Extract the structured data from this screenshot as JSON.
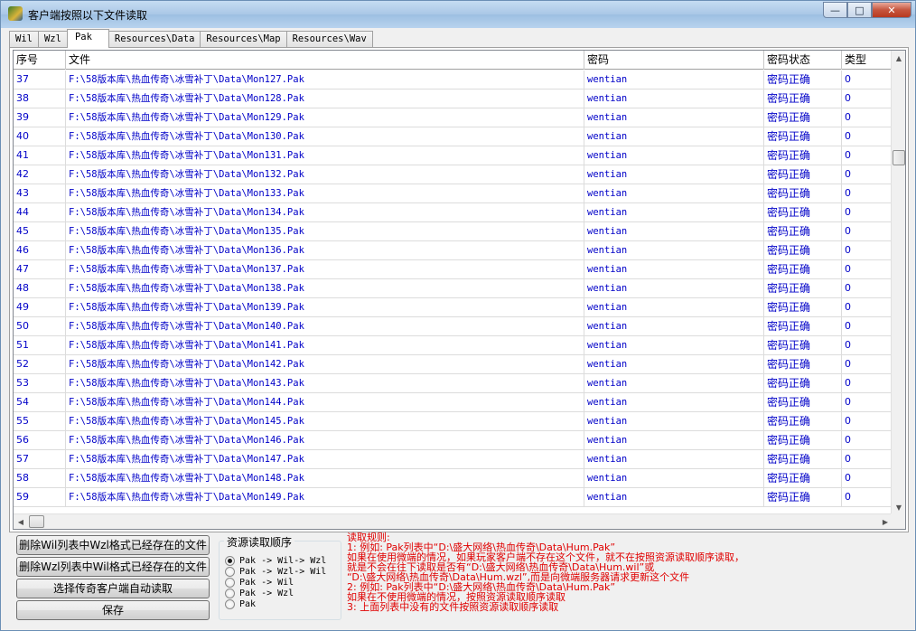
{
  "window": {
    "title": "客户端按照以下文件读取"
  },
  "title_buttons": {
    "minimize": "—",
    "maximize": "□",
    "close": "✕"
  },
  "tabs": [
    "Wil",
    "Wzl",
    "Pak",
    "Resources\\Data",
    "Resources\\Map",
    "Resources\\Wav"
  ],
  "active_tab": "Pak",
  "table": {
    "columns": [
      "序号",
      "文件",
      "密码",
      "密码状态",
      "类型"
    ],
    "rows": [
      [
        "37",
        "F:\\58版本库\\热血传奇\\冰雪补丁\\Data\\Mon127.Pak",
        "wentian",
        "密码正确",
        "0"
      ],
      [
        "38",
        "F:\\58版本库\\热血传奇\\冰雪补丁\\Data\\Mon128.Pak",
        "wentian",
        "密码正确",
        "0"
      ],
      [
        "39",
        "F:\\58版本库\\热血传奇\\冰雪补丁\\Data\\Mon129.Pak",
        "wentian",
        "密码正确",
        "0"
      ],
      [
        "40",
        "F:\\58版本库\\热血传奇\\冰雪补丁\\Data\\Mon130.Pak",
        "wentian",
        "密码正确",
        "0"
      ],
      [
        "41",
        "F:\\58版本库\\热血传奇\\冰雪补丁\\Data\\Mon131.Pak",
        "wentian",
        "密码正确",
        "0"
      ],
      [
        "42",
        "F:\\58版本库\\热血传奇\\冰雪补丁\\Data\\Mon132.Pak",
        "wentian",
        "密码正确",
        "0"
      ],
      [
        "43",
        "F:\\58版本库\\热血传奇\\冰雪补丁\\Data\\Mon133.Pak",
        "wentian",
        "密码正确",
        "0"
      ],
      [
        "44",
        "F:\\58版本库\\热血传奇\\冰雪补丁\\Data\\Mon134.Pak",
        "wentian",
        "密码正确",
        "0"
      ],
      [
        "45",
        "F:\\58版本库\\热血传奇\\冰雪补丁\\Data\\Mon135.Pak",
        "wentian",
        "密码正确",
        "0"
      ],
      [
        "46",
        "F:\\58版本库\\热血传奇\\冰雪补丁\\Data\\Mon136.Pak",
        "wentian",
        "密码正确",
        "0"
      ],
      [
        "47",
        "F:\\58版本库\\热血传奇\\冰雪补丁\\Data\\Mon137.Pak",
        "wentian",
        "密码正确",
        "0"
      ],
      [
        "48",
        "F:\\58版本库\\热血传奇\\冰雪补丁\\Data\\Mon138.Pak",
        "wentian",
        "密码正确",
        "0"
      ],
      [
        "49",
        "F:\\58版本库\\热血传奇\\冰雪补丁\\Data\\Mon139.Pak",
        "wentian",
        "密码正确",
        "0"
      ],
      [
        "50",
        "F:\\58版本库\\热血传奇\\冰雪补丁\\Data\\Mon140.Pak",
        "wentian",
        "密码正确",
        "0"
      ],
      [
        "51",
        "F:\\58版本库\\热血传奇\\冰雪补丁\\Data\\Mon141.Pak",
        "wentian",
        "密码正确",
        "0"
      ],
      [
        "52",
        "F:\\58版本库\\热血传奇\\冰雪补丁\\Data\\Mon142.Pak",
        "wentian",
        "密码正确",
        "0"
      ],
      [
        "53",
        "F:\\58版本库\\热血传奇\\冰雪补丁\\Data\\Mon143.Pak",
        "wentian",
        "密码正确",
        "0"
      ],
      [
        "54",
        "F:\\58版本库\\热血传奇\\冰雪补丁\\Data\\Mon144.Pak",
        "wentian",
        "密码正确",
        "0"
      ],
      [
        "55",
        "F:\\58版本库\\热血传奇\\冰雪补丁\\Data\\Mon145.Pak",
        "wentian",
        "密码正确",
        "0"
      ],
      [
        "56",
        "F:\\58版本库\\热血传奇\\冰雪补丁\\Data\\Mon146.Pak",
        "wentian",
        "密码正确",
        "0"
      ],
      [
        "57",
        "F:\\58版本库\\热血传奇\\冰雪补丁\\Data\\Mon147.Pak",
        "wentian",
        "密码正确",
        "0"
      ],
      [
        "58",
        "F:\\58版本库\\热血传奇\\冰雪补丁\\Data\\Mon148.Pak",
        "wentian",
        "密码正确",
        "0"
      ],
      [
        "59",
        "F:\\58版本库\\热血传奇\\冰雪补丁\\Data\\Mon149.Pak",
        "wentian",
        "密码正确",
        "0"
      ]
    ]
  },
  "buttons": {
    "delete_wil": "删除Wil列表中Wzl格式已经存在的文件",
    "delete_wzl": "删除Wzl列表中Wil格式已经存在的文件",
    "auto_read": "选择传奇客户端自动读取",
    "save": "保存"
  },
  "resource_order": {
    "title": "资源读取顺序",
    "options": [
      "Pak -> Wil-> Wzl",
      "Pak -> Wzl-> Wil",
      "Pak -> Wil",
      "Pak -> Wzl",
      "Pak"
    ],
    "selected_index": 0
  },
  "rules": [
    "读取规则:",
    "1: 例如: Pak列表中“D:\\盛大网络\\热血传奇\\Data\\Hum.Pak”",
    "    如果在使用微端的情况，如果玩家客户端不存在这个文件，就不在按照资源读取顺序读取，",
    "    就是不会在往下读取是否有“D:\\盛大网络\\热血传奇\\Data\\Hum.wil”或",
    "  “D:\\盛大网络\\热血传奇\\Data\\Hum.wzl”,而是向微端服务器请求更新这个文件",
    "2: 例如: Pak列表中“D:\\盛大网络\\热血传奇\\Data\\Hum.Pak”",
    "    如果在不使用微端的情况，按照资源读取顺序读取",
    "3: 上面列表中没有的文件按照资源读取顺序读取"
  ],
  "colors": {
    "cell_text": "#0000c8",
    "rules_text": "#e00000"
  }
}
